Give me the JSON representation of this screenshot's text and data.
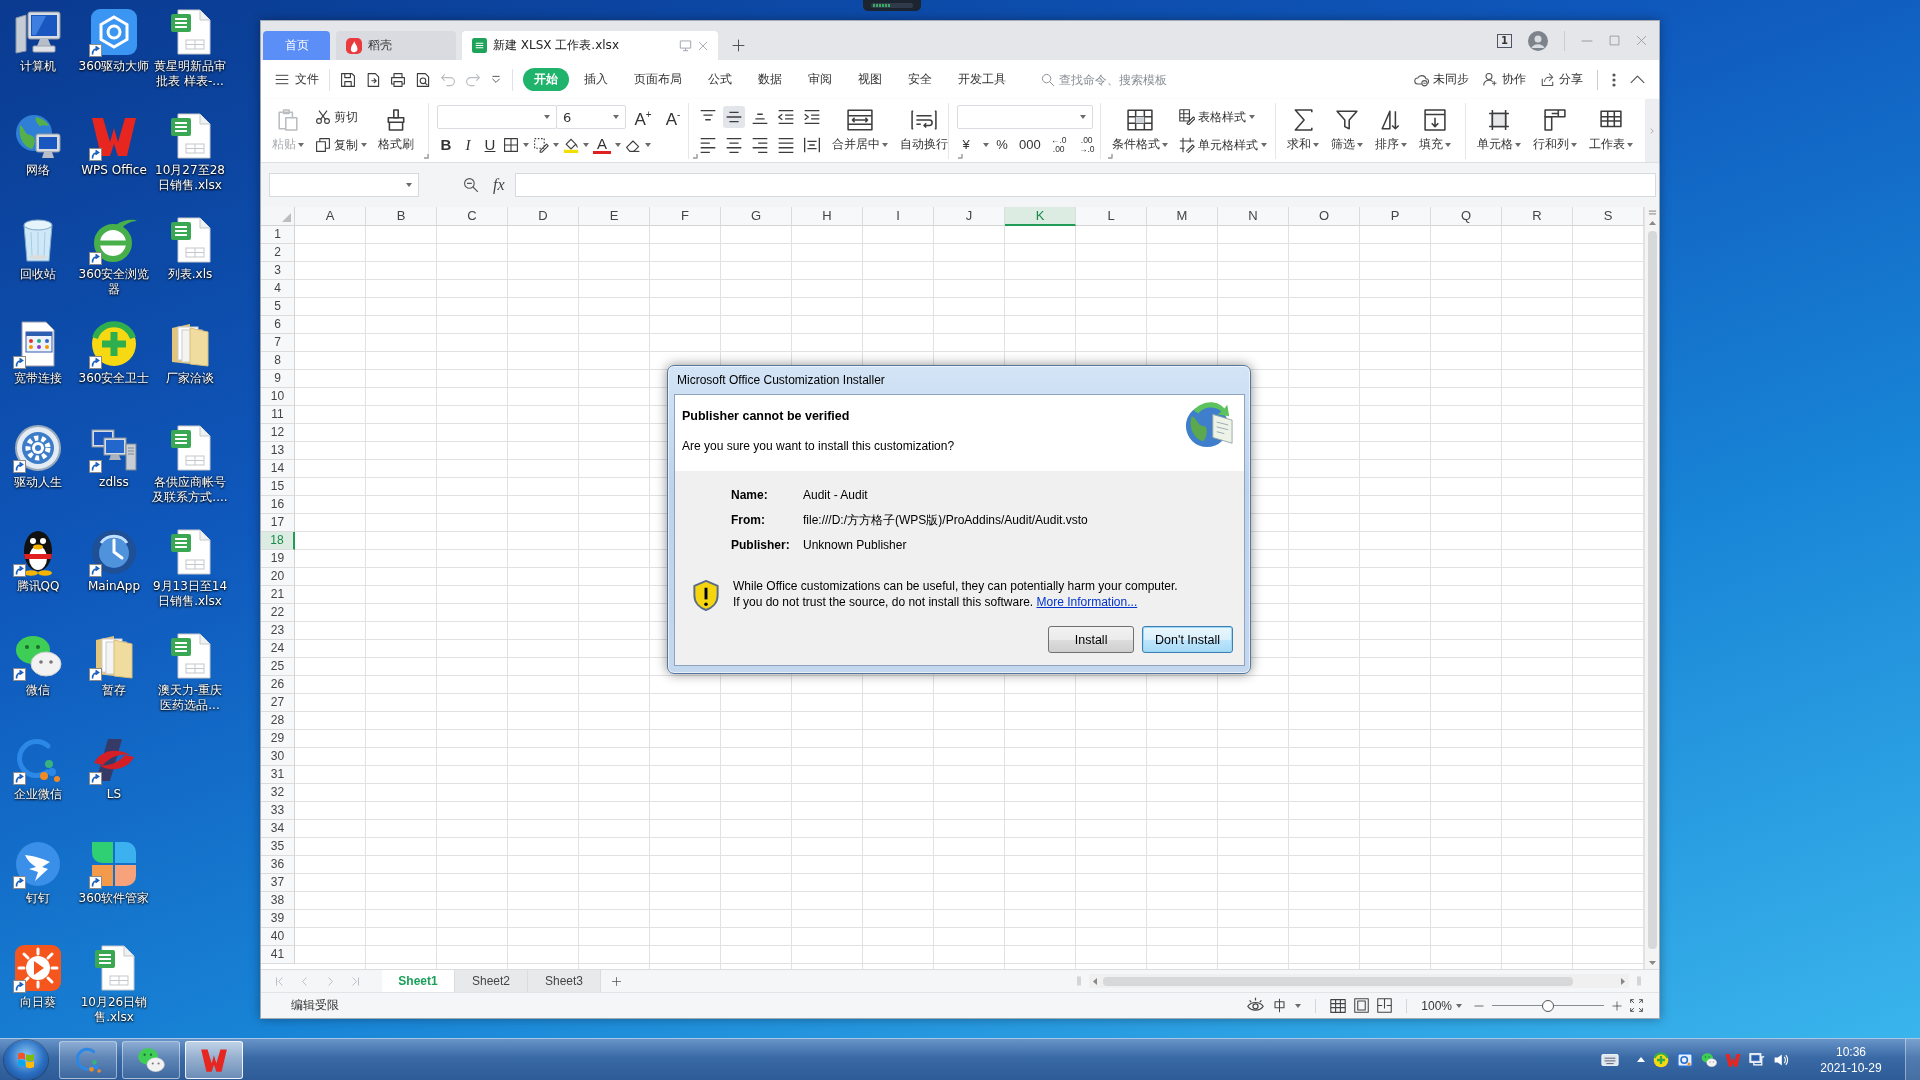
{
  "desktop": {
    "icons": [
      {
        "label": "计算机",
        "shortcut": false
      },
      {
        "label": "网络",
        "shortcut": false
      },
      {
        "label": "回收站",
        "shortcut": false
      },
      {
        "label": "宽带连接",
        "shortcut": true
      },
      {
        "label": "驱动人生",
        "shortcut": true
      },
      {
        "label": "腾讯QQ",
        "shortcut": true
      },
      {
        "label": "微信",
        "shortcut": true
      },
      {
        "label": "企业微信",
        "shortcut": true
      },
      {
        "label": "钉钉",
        "shortcut": true
      },
      {
        "label": "向日葵",
        "shortcut": true
      },
      {
        "label": "360驱动大师",
        "shortcut": true
      },
      {
        "label": "WPS Office",
        "shortcut": true
      },
      {
        "label": "360安全浏览器",
        "shortcut": true
      },
      {
        "label": "360安全卫士",
        "shortcut": true
      },
      {
        "label": "zdlss",
        "shortcut": true
      },
      {
        "label": "MainApp",
        "shortcut": true
      },
      {
        "label": "暂存",
        "shortcut": true
      },
      {
        "label": "LS",
        "shortcut": true
      },
      {
        "label": "360软件管家",
        "shortcut": true
      },
      {
        "label": "10月26日销售.xlsx",
        "shortcut": false
      },
      {
        "label": "黄星明新品审批表 样表-...",
        "shortcut": false
      },
      {
        "label": "10月27至28日销售.xlsx",
        "shortcut": false
      },
      {
        "label": "列表.xls",
        "shortcut": false
      },
      {
        "label": "厂家洽谈",
        "shortcut": false
      },
      {
        "label": "各供应商帐号及联系方式....",
        "shortcut": false
      },
      {
        "label": "9月13日至14日销售.xlsx",
        "shortcut": false
      },
      {
        "label": "澳天力-重庆医药选品...",
        "shortcut": false
      }
    ]
  },
  "wps": {
    "tabs": [
      {
        "label": "首页",
        "kind": "home",
        "selected": false
      },
      {
        "label": "稻壳",
        "kind": "docer",
        "selected": false
      },
      {
        "label": "新建 XLSX 工作表.xlsx",
        "kind": "document",
        "selected": true
      }
    ],
    "window_count": "1",
    "menu": {
      "file": "文件",
      "quick_access": [
        {
          "disabled": false
        },
        {
          "disabled": false
        },
        {
          "disabled": false
        },
        {
          "disabled": false
        },
        {
          "disabled": true
        },
        {
          "disabled": true
        },
        {
          "disabled": false
        }
      ],
      "tabs": [
        {
          "label": "开始",
          "selected": true
        },
        {
          "label": "插入",
          "selected": false
        },
        {
          "label": "页面布局",
          "selected": false
        },
        {
          "label": "公式",
          "selected": false
        },
        {
          "label": "数据",
          "selected": false
        },
        {
          "label": "审阅",
          "selected": false
        },
        {
          "label": "视图",
          "selected": false
        },
        {
          "label": "安全",
          "selected": false
        },
        {
          "label": "开发工具",
          "selected": false
        }
      ],
      "search": {
        "placeholder": "查找命令、搜索模板"
      },
      "actions": [
        "未同步",
        "协作",
        "分享"
      ]
    },
    "ribbon": {
      "clipboard": {
        "paste": {
          "label": "粘贴",
          "disabled": true
        },
        "cut": "剪切",
        "copy": "复制",
        "format_painter": "格式刷"
      },
      "font": {
        "size": "6",
        "grow": "A$^{+}$",
        "shrink": "A$^{-}$",
        "bold": "B",
        "italic": "I",
        "underline": "U",
        "font_color": "A"
      },
      "alignment": {
        "buttons": [
          {
            "selected": false
          },
          {
            "selected": true
          },
          {
            "selected": false
          },
          {
            "selected": false
          },
          {
            "selected": false
          },
          {
            "selected": false
          },
          {
            "selected": false
          },
          {
            "selected": false
          },
          {
            "selected": false
          },
          {
            "selected": false
          }
        ],
        "merge": "合并居中",
        "wrap": "自动换行"
      },
      "number": [
        "¥",
        "%",
        "000",
        "←.0 .00",
        ".00 →.0"
      ],
      "styles": {
        "conditional": "条件格式",
        "table_style": "表格样式",
        "cell_style": "单元格样式"
      },
      "editing": [
        "求和",
        "筛选",
        "排序",
        "填充"
      ],
      "cells": [
        "单元格",
        "行和列",
        "工作表"
      ]
    },
    "formula_bar": {
      "fx": "fx"
    },
    "columns": [
      {
        "label": "A",
        "selected": false
      },
      {
        "label": "B",
        "selected": false
      },
      {
        "label": "C",
        "selected": false
      },
      {
        "label": "D",
        "selected": false
      },
      {
        "label": "E",
        "selected": false
      },
      {
        "label": "F",
        "selected": false
      },
      {
        "label": "G",
        "selected": false
      },
      {
        "label": "H",
        "selected": false
      },
      {
        "label": "I",
        "selected": false
      },
      {
        "label": "J",
        "selected": false
      },
      {
        "label": "K",
        "selected": true
      },
      {
        "label": "L",
        "selected": false
      },
      {
        "label": "M",
        "selected": false
      },
      {
        "label": "N",
        "selected": false
      },
      {
        "label": "O",
        "selected": false
      },
      {
        "label": "P",
        "selected": false
      },
      {
        "label": "Q",
        "selected": false
      },
      {
        "label": "R",
        "selected": false
      },
      {
        "label": "S",
        "selected": false
      }
    ],
    "rows": [
      {
        "label": "1",
        "selected": false
      },
      {
        "label": "2",
        "selected": false
      },
      {
        "label": "3",
        "selected": false
      },
      {
        "label": "4",
        "selected": false
      },
      {
        "label": "5",
        "selected": false
      },
      {
        "label": "6",
        "selected": false
      },
      {
        "label": "7",
        "selected": false
      },
      {
        "label": "8",
        "selected": false
      },
      {
        "label": "9",
        "selected": false
      },
      {
        "label": "10",
        "selected": false
      },
      {
        "label": "11",
        "selected": false
      },
      {
        "label": "12",
        "selected": false
      },
      {
        "label": "13",
        "selected": false
      },
      {
        "label": "14",
        "selected": false
      },
      {
        "label": "15",
        "selected": false
      },
      {
        "label": "16",
        "selected": false
      },
      {
        "label": "17",
        "selected": false
      },
      {
        "label": "18",
        "selected": true
      },
      {
        "label": "19",
        "selected": false
      },
      {
        "label": "20",
        "selected": false
      },
      {
        "label": "21",
        "selected": false
      },
      {
        "label": "22",
        "selected": false
      },
      {
        "label": "23",
        "selected": false
      },
      {
        "label": "24",
        "selected": false
      },
      {
        "label": "25",
        "selected": false
      },
      {
        "label": "26",
        "selected": false
      },
      {
        "label": "27",
        "selected": false
      },
      {
        "label": "28",
        "selected": false
      },
      {
        "label": "29",
        "selected": false
      },
      {
        "label": "30",
        "selected": false
      },
      {
        "label": "31",
        "selected": false
      },
      {
        "label": "32",
        "selected": false
      },
      {
        "label": "33",
        "selected": false
      },
      {
        "label": "34",
        "selected": false
      },
      {
        "label": "35",
        "selected": false
      },
      {
        "label": "36",
        "selected": false
      },
      {
        "label": "37",
        "selected": false
      },
      {
        "label": "38",
        "selected": false
      },
      {
        "label": "39",
        "selected": false
      },
      {
        "label": "40",
        "selected": false
      },
      {
        "label": "41",
        "selected": false
      }
    ],
    "sheet_tabs": [
      {
        "label": "Sheet1",
        "selected": true
      },
      {
        "label": "Sheet2",
        "selected": false
      },
      {
        "label": "Sheet3",
        "selected": false
      }
    ],
    "status_bar": {
      "text": "编辑受限",
      "zoom": "100%",
      "zoom_slider": {
        "level": 0.5
      }
    }
  },
  "dialog": {
    "title": "Microsoft Office Customization Installer",
    "heading": "Publisher cannot be verified",
    "question": "Are you sure you want to install this customization?",
    "details": [
      {
        "label": "Name:",
        "value": "Audit - Audit"
      },
      {
        "label": "From:",
        "value": "file:///D:/方方格子(WPS版)/ProAddins/Audit/Audit.vsto"
      },
      {
        "label": "Publisher:",
        "value": "Unknown Publisher"
      }
    ],
    "warning": [
      "While Office customizations can be useful, they can potentially harm your computer.",
      "If you do not trust the source, do not install this software."
    ],
    "link": "More Information...",
    "buttons": [
      {
        "label": "Install",
        "focused": false
      },
      {
        "label": "Don't Install",
        "focused": true
      }
    ]
  },
  "taskbar": {
    "buttons": [
      {
        "selected": false
      },
      {
        "selected": false
      },
      {
        "selected": true
      }
    ],
    "clock": {
      "time": "10:36",
      "date": "2021-10-29"
    }
  }
}
